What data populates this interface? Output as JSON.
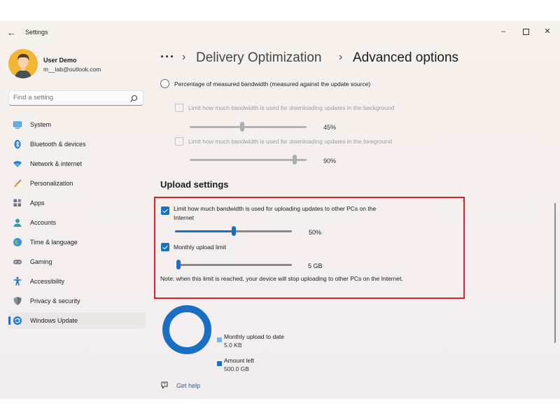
{
  "window": {
    "app_title": "Settings",
    "controls": {
      "minimize": "–",
      "maximize": "",
      "close": "✕"
    }
  },
  "user": {
    "name": "User Demo",
    "email": "m__lab@outlook.com"
  },
  "search": {
    "placeholder": "Find a setting",
    "value": ""
  },
  "sidebar": {
    "items": [
      {
        "label": "System",
        "icon": "monitor-icon"
      },
      {
        "label": "Bluetooth & devices",
        "icon": "bluetooth-icon"
      },
      {
        "label": "Network & internet",
        "icon": "wifi-icon"
      },
      {
        "label": "Personalization",
        "icon": "brush-icon"
      },
      {
        "label": "Apps",
        "icon": "apps-icon"
      },
      {
        "label": "Accounts",
        "icon": "person-icon"
      },
      {
        "label": "Time & language",
        "icon": "globe-icon"
      },
      {
        "label": "Gaming",
        "icon": "gamepad-icon"
      },
      {
        "label": "Accessibility",
        "icon": "accessibility-icon"
      },
      {
        "label": "Privacy & security",
        "icon": "shield-icon"
      },
      {
        "label": "Windows Update",
        "icon": "update-icon",
        "selected": true
      }
    ]
  },
  "breadcrumb": {
    "more": "···",
    "separator": "›",
    "parent": "Delivery Optimization",
    "current": "Advanced options"
  },
  "download": {
    "radio_label": "Percentage of measured bandwidth (measured against the update source)",
    "radio_selected": false,
    "background": {
      "label": "Limit how much bandwidth is used for downloading updates in the background",
      "checked": false,
      "enabled": false,
      "value_percent": 45,
      "value_text": "45%"
    },
    "foreground": {
      "label": "Limit how much bandwidth is used for downloading updates in the foreground",
      "checked": false,
      "enabled": false,
      "value_percent": 90,
      "value_text": "90%"
    }
  },
  "upload": {
    "section_title": "Upload settings",
    "bandwidth": {
      "label_line1": "Limit how much bandwidth is used for uploading updates to other PCs on the",
      "label_line2": "Internet",
      "checked": true,
      "value_percent": 50,
      "value_text": "50%"
    },
    "monthly": {
      "label": "Monthly upload limit",
      "checked": true,
      "value_fraction": 0.0,
      "value_text": "5 GB"
    },
    "note": "Note: when this limit is reached, your device will stop uploading to other PCs on the Internet."
  },
  "usage": {
    "uploaded": {
      "label": "Monthly upload to date",
      "value": "5.0 KB",
      "color": "#7fb3e0"
    },
    "remaining": {
      "label": "Amount left",
      "value": "500.0 GB",
      "color": "#1a6fc4"
    },
    "uploaded_fraction": 0.0
  },
  "help": {
    "label": "Get help"
  },
  "colors": {
    "accent": "#1a6fc4",
    "highlight_border": "#d9212b"
  }
}
